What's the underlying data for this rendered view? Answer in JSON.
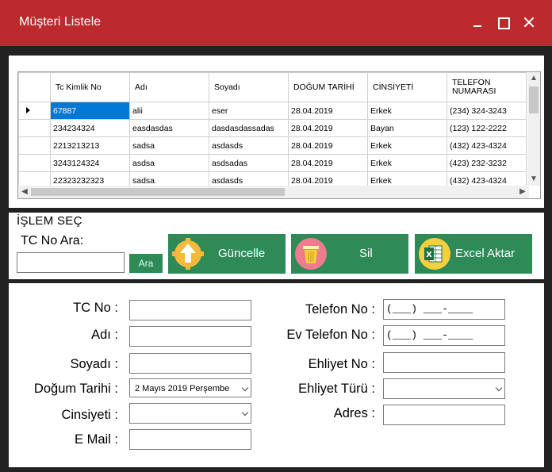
{
  "window": {
    "title": "Müşteri Listele"
  },
  "grid": {
    "columns": [
      "Tc Kimlik No",
      "Adı",
      "Soyadı",
      "DOĞUM TARİHİ",
      "CİNSİYETİ",
      "TELEFON NUMARASI"
    ],
    "rows": [
      [
        "67887",
        "alii",
        "eser",
        "28.04.2019",
        "Erkek",
        "(234) 324-3243"
      ],
      [
        "234234324",
        "easdasdas",
        "dasdasdassadas",
        "28.04.2019",
        "Bayan",
        "(123) 122-2222"
      ],
      [
        "2213213213",
        "sadsa",
        "asdasds",
        "28.04.2019",
        "Erkek",
        "(432) 423-4324"
      ],
      [
        "3243124324",
        "asdsa",
        "asdsadas",
        "28.04.2019",
        "Erkek",
        "(423) 232-3232"
      ],
      [
        "22323232323",
        "sadsa",
        "asdasds",
        "28.04.2019",
        "Erkek",
        "(432) 423-4324"
      ]
    ]
  },
  "ops": {
    "title": "İŞLEM SEÇ",
    "search_label": "TC No Ara:",
    "search_value": "",
    "search_button": "Ara",
    "update_button": "Güncelle",
    "delete_button": "Sil",
    "excel_button": "Excel Aktar"
  },
  "form": {
    "tc_label": "TC No :",
    "name_label": "Adı :",
    "surname_label": "Soyadı :",
    "birth_label": "Doğum Tarihi :",
    "birth_value": "2   Mayıs   2019 Perşembe",
    "gender_label": "Cinsiyeti :",
    "email_label": "E Mail :",
    "phone_label": "Telefon No :",
    "phone_value": "(___) ___-____",
    "home_phone_label": "Ev Telefon No :",
    "home_phone_value": "(___) ___-____",
    "license_label": "Ehliyet No :",
    "license_type_label": "Ehliyet Türü :",
    "address_label": "Adres :"
  },
  "colors": {
    "titlebar": "#bc2a2e",
    "button": "#2e8b57",
    "selection": "#0078d7"
  }
}
